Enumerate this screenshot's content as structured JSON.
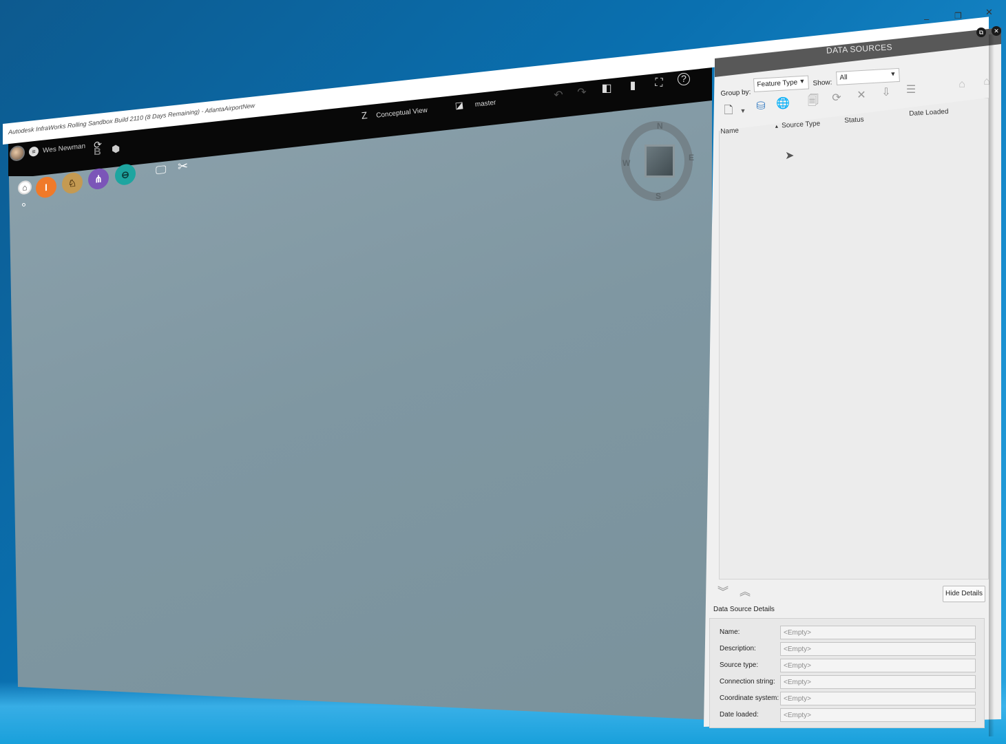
{
  "window": {
    "title": "Autodesk InfraWorks Rolling Sandbox Build 2110 (8 Days Remaining) - AtlantaAirportNew",
    "minimize": "–",
    "restore": "❐",
    "close": "✕"
  },
  "user": {
    "name": "Wes Newman"
  },
  "viewport": {
    "visual_style": "Conceptual View",
    "proposal": "master"
  },
  "compass": {
    "north": "N",
    "south": "S",
    "east": "E",
    "west": "W"
  },
  "tools": {
    "home": "⌂",
    "build": "I",
    "analyze": "♘",
    "bridge": "⋔",
    "drainage": "⊖",
    "present": "🖵",
    "settings": "✂"
  },
  "panel": {
    "title": "DATA SOURCES",
    "group_by_label": "Group by:",
    "group_by_value": "Feature Type",
    "show_label": "Show:",
    "show_value": "All",
    "columns": [
      "Name",
      "Source Type",
      "Status",
      "Date Loaded"
    ],
    "hide_details": "Hide Details",
    "details_title": "Data Source Details",
    "details": [
      {
        "label": "Name:",
        "value": "<Empty>"
      },
      {
        "label": "Description:",
        "value": "<Empty>"
      },
      {
        "label": "Source type:",
        "value": "<Empty>"
      },
      {
        "label": "Connection string:",
        "value": "<Empty>"
      },
      {
        "label": "Coordinate system:",
        "value": "<Empty>"
      },
      {
        "label": "Date loaded:",
        "value": "<Empty>"
      }
    ]
  },
  "colors": {
    "viewport": "#8599a3",
    "topbar": "#080808",
    "panel_header": "#585858",
    "tool_build": "#f07a2a",
    "tool_analyze": "#c49a52",
    "tool_bridge": "#7b55b8",
    "tool_drainage": "#1ea5a0"
  }
}
